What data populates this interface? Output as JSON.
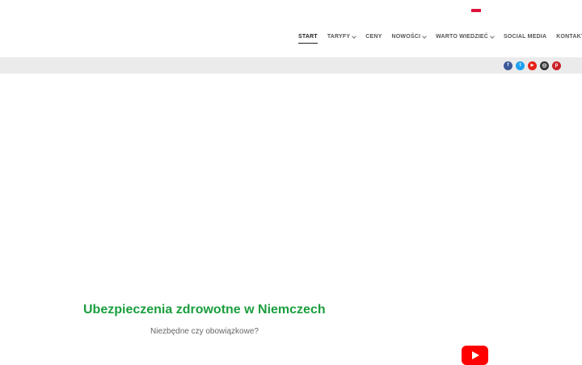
{
  "language": {
    "flag_colors": [
      "#ffffff",
      "#dc143c"
    ]
  },
  "nav": {
    "items": [
      {
        "label": "START",
        "active": true,
        "dropdown": false
      },
      {
        "label": "TARYFY",
        "active": false,
        "dropdown": true
      },
      {
        "label": "CENY",
        "active": false,
        "dropdown": false
      },
      {
        "label": "NOWOŚCI",
        "active": false,
        "dropdown": true
      },
      {
        "label": "WARTO WIEDZIEĆ",
        "active": false,
        "dropdown": true
      },
      {
        "label": "SOCIAL MEDIA",
        "active": false,
        "dropdown": false
      },
      {
        "label": "KONTAKT",
        "active": false,
        "dropdown": false
      }
    ]
  },
  "social": {
    "icons": [
      {
        "name": "facebook-icon",
        "glyph": "f",
        "color": "#3b5998"
      },
      {
        "name": "twitter-icon",
        "glyph": "t",
        "color": "#1da1f2"
      },
      {
        "name": "youtube-icon",
        "glyph": "▶",
        "color": "#e62117"
      },
      {
        "name": "instagram-icon",
        "glyph": "◎",
        "color": "#333333"
      },
      {
        "name": "pinterest-icon",
        "glyph": "p",
        "color": "#cb2027"
      }
    ]
  },
  "hero": {
    "title": "Ubezpieczenia zdrowotne w Niemczech",
    "subtitle": "Niezbędne czy obowiązkowe?",
    "title_color": "#1b9e3e"
  },
  "video": {
    "icon": "youtube-play-icon",
    "color": "#ff0000"
  }
}
